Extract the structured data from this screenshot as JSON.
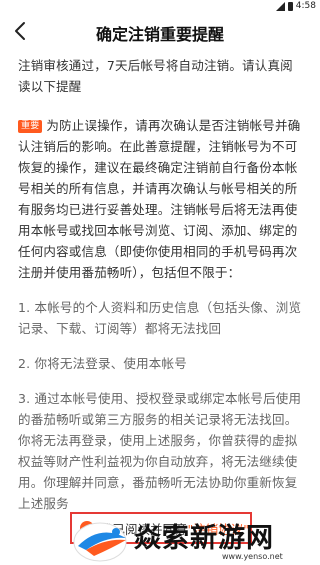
{
  "statusbar": {
    "time": "4:58"
  },
  "header": {
    "title": "确定注销重要提醒"
  },
  "intro_text": "注销审核通过，7天后帐号将自动注销。请认真阅读以下提醒",
  "important_tag": "重要",
  "important_text": "为防止误操作，请再次确认是否注销帐号并确认注销后的影响。在此善意提醒，注销帐号为不可恢复的操作，建议在最终确定注销前自行备份本帐号相关的所有信息，并请再次确认与帐号相关的所有服务均已进行妥善处理。注销帐号后将无法再使用本帐号或找回本帐号浏览、订阅、添加、绑定的任何内容或信息（即使你使用相同的手机号码再次注册并使用番茄畅听），包括但不限于：",
  "items": [
    "1. 本帐号的个人资料和历史信息（包括头像、浏览记录、下载、订阅等）都将无法找回",
    "2. 你将无法登录、使用本帐号",
    "3. 通过本帐号使用、授权登录或绑定本帐号后使用的番茄畅听或第三方服务的相关记录将无法找回。你将无法再登录，使用上述服务，你曾获得的虚拟权益等财产性利益视为你自动放弃，将无法继续使用。你理解并同意，番茄畅听无法协助你重新恢复上述服务"
  ],
  "agree": {
    "prefix": "我已阅读并同意",
    "link": "\"注销协议\""
  },
  "watermark": {
    "text": "焱索新游网",
    "url": "www.yenso.net"
  },
  "colors": {
    "accent": "#ff5a1f",
    "highlight_border": "#e53935"
  }
}
